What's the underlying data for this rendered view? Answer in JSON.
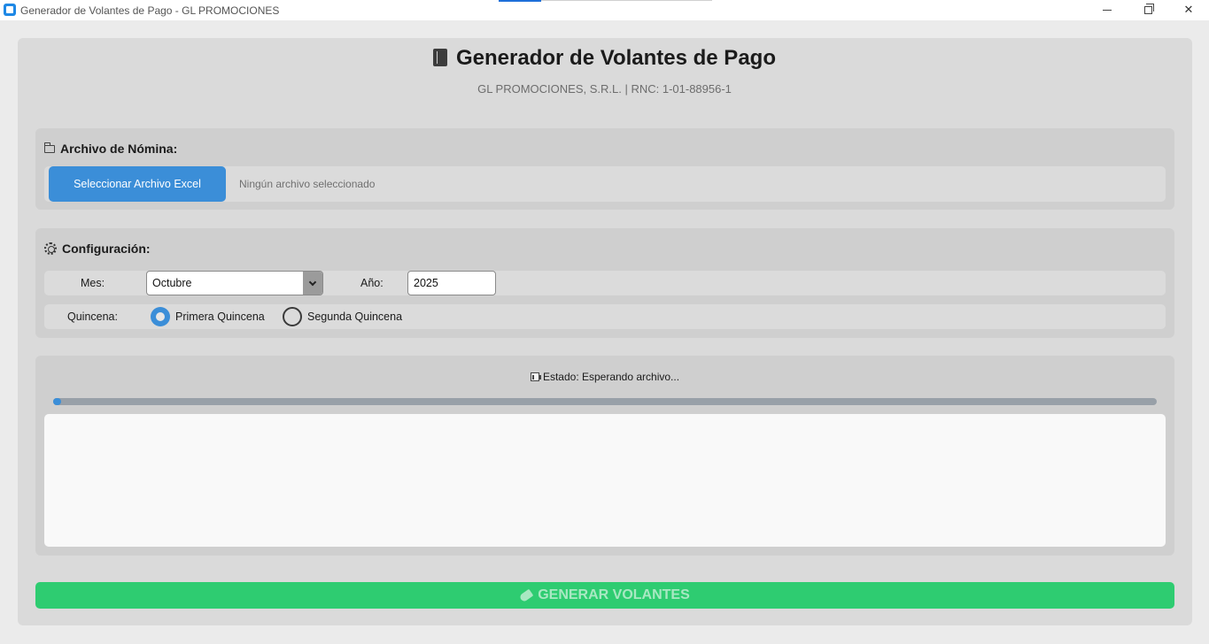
{
  "window": {
    "title": "Generador de Volantes de Pago - GL PROMOCIONES"
  },
  "header": {
    "title": "Generador de Volantes de Pago",
    "subtitle": "GL PROMOCIONES, S.R.L. | RNC: 1-01-88956-1"
  },
  "archivo": {
    "section_label": "Archivo de Nómina:",
    "select_button_label": "Seleccionar Archivo Excel",
    "file_status": "Ningún archivo seleccionado"
  },
  "config": {
    "section_label": "Configuración:",
    "mes_label": "Mes:",
    "mes_value": "Octubre",
    "anio_label": "Año:",
    "anio_value": "2025",
    "quincena_label": "Quincena:",
    "quincena_options": [
      {
        "label": "Primera Quincena",
        "selected": true
      },
      {
        "label": "Segunda Quincena",
        "selected": false
      }
    ]
  },
  "status": {
    "text": "Estado: Esperando archivo...",
    "progress": 0.0,
    "log_text": ""
  },
  "actions": {
    "generate_label": "GENERAR VOLANTES"
  },
  "colors": {
    "accent": "#3b8ed8",
    "generate": "#2ecc71",
    "card": "#dadada",
    "section": "#cfcfcf"
  },
  "icons": {
    "title": "book-icon",
    "archivo": "folder-icon",
    "config": "gear-icon",
    "status": "chart-icon",
    "generate": "rocket-icon"
  }
}
